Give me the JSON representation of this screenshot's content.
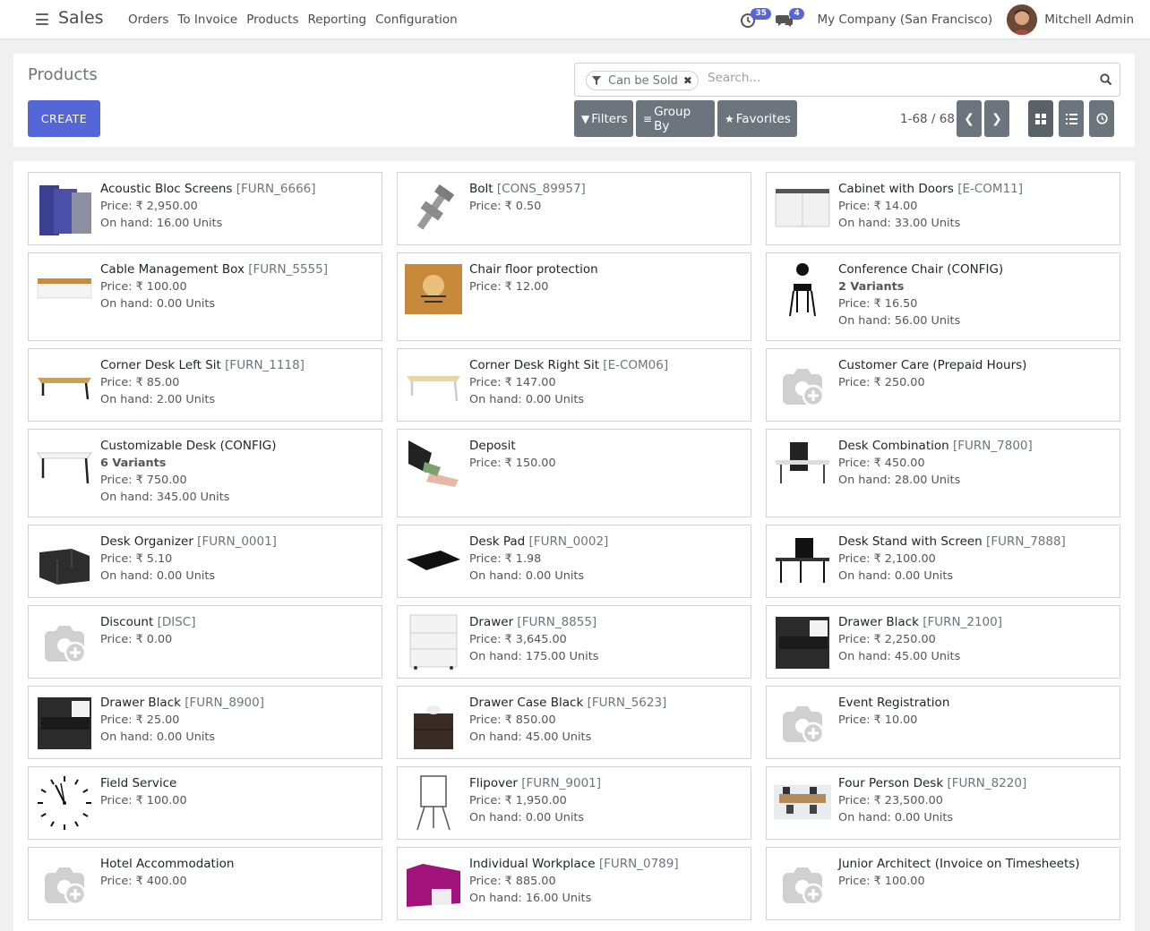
{
  "navbar": {
    "app_name": "Sales",
    "menu": [
      "Orders",
      "To Invoice",
      "Products",
      "Reporting",
      "Configuration"
    ],
    "activity_count": "35",
    "message_count": "4",
    "company": "My Company (San Francisco)",
    "user": "Mitchell Admin"
  },
  "control": {
    "breadcrumb": "Products",
    "create_label": "CREATE",
    "facet_label": "Can be Sold",
    "search_placeholder": "Search...",
    "filters_label": "Filters",
    "groupby_label": "Group By",
    "favorites_label": "Favorites",
    "pager": "1-68 / 68"
  },
  "colors": {
    "primary": "#5466d8",
    "secondary": "#6c757d"
  },
  "products": [
    {
      "name": "Acoustic Bloc Screens",
      "code": "[FURN_6666]",
      "price": "Price: ₹ 2,950.00",
      "onhand": "On hand: 16.00 Units",
      "variants": "",
      "image": "acoustic-screen"
    },
    {
      "name": "Bolt",
      "code": "[CONS_89957]",
      "price": "Price: ₹ 0.50",
      "onhand": "",
      "variants": "",
      "image": "bolt"
    },
    {
      "name": "Cabinet with Doors",
      "code": "[E-COM11]",
      "price": "Price: ₹ 14.00",
      "onhand": "On hand: 33.00 Units",
      "variants": "",
      "image": "cabinet"
    },
    {
      "name": "Cable Management Box",
      "code": "[FURN_5555]",
      "price": "Price: ₹ 100.00",
      "onhand": "On hand: 0.00 Units",
      "variants": "",
      "image": "cable-box"
    },
    {
      "name": "Chair floor protection",
      "code": "",
      "price": "Price: ₹ 12.00",
      "onhand": "",
      "variants": "",
      "image": "floor-protection"
    },
    {
      "name": "Conference Chair (CONFIG)",
      "code": "",
      "price": "Price: ₹ 16.50",
      "onhand": "On hand: 56.00 Units",
      "variants": "2 Variants",
      "image": "chair"
    },
    {
      "name": "Corner Desk Left Sit",
      "code": "[FURN_1118]",
      "price": "Price: ₹ 85.00",
      "onhand": "On hand: 2.00 Units",
      "variants": "",
      "image": "desk-wood"
    },
    {
      "name": "Corner Desk Right Sit",
      "code": "[E-COM06]",
      "price": "Price: ₹ 147.00",
      "onhand": "On hand: 0.00 Units",
      "variants": "",
      "image": "desk-light"
    },
    {
      "name": "Customer Care (Prepaid Hours)",
      "code": "",
      "price": "Price: ₹ 250.00",
      "onhand": "",
      "variants": "",
      "image": "placeholder"
    },
    {
      "name": "Customizable Desk (CONFIG)",
      "code": "",
      "price": "Price: ₹ 750.00",
      "onhand": "On hand: 345.00 Units",
      "variants": "6 Variants",
      "image": "desk-white"
    },
    {
      "name": "Deposit",
      "code": "",
      "price": "Price: ₹ 150.00",
      "onhand": "",
      "variants": "",
      "image": "deposit"
    },
    {
      "name": "Desk Combination",
      "code": "[FURN_7800]",
      "price": "Price: ₹ 450.00",
      "onhand": "On hand: 28.00 Units",
      "variants": "",
      "image": "desk-combo"
    },
    {
      "name": "Desk Organizer",
      "code": "[FURN_0001]",
      "price": "Price: ₹ 5.10",
      "onhand": "On hand: 0.00 Units",
      "variants": "",
      "image": "organizer"
    },
    {
      "name": "Desk Pad",
      "code": "[FURN_0002]",
      "price": "Price: ₹ 1.98",
      "onhand": "On hand: 0.00 Units",
      "variants": "",
      "image": "desk-pad"
    },
    {
      "name": "Desk Stand with Screen",
      "code": "[FURN_7888]",
      "price": "Price: ₹ 2,100.00",
      "onhand": "On hand: 0.00 Units",
      "variants": "",
      "image": "desk-stand"
    },
    {
      "name": "Discount",
      "code": "[DISC]",
      "price": "Price: ₹ 0.00",
      "onhand": "",
      "variants": "",
      "image": "placeholder"
    },
    {
      "name": "Drawer",
      "code": "[FURN_8855]",
      "price": "Price: ₹ 3,645.00",
      "onhand": "On hand: 175.00 Units",
      "variants": "",
      "image": "drawer-white"
    },
    {
      "name": "Drawer Black",
      "code": "[FURN_2100]",
      "price": "Price: ₹ 2,250.00",
      "onhand": "On hand: 45.00 Units",
      "variants": "",
      "image": "drawer-black"
    },
    {
      "name": "Drawer Black",
      "code": "[FURN_8900]",
      "price": "Price: ₹ 25.00",
      "onhand": "On hand: 0.00 Units",
      "variants": "",
      "image": "drawer-black"
    },
    {
      "name": "Drawer Case Black",
      "code": "[FURN_5623]",
      "price": "Price: ₹ 850.00",
      "onhand": "On hand: 45.00 Units",
      "variants": "",
      "image": "drawer-case"
    },
    {
      "name": "Event Registration",
      "code": "",
      "price": "Price: ₹ 10.00",
      "onhand": "",
      "variants": "",
      "image": "placeholder"
    },
    {
      "name": "Field Service",
      "code": "",
      "price": "Price: ₹ 100.00",
      "onhand": "",
      "variants": "",
      "image": "clock"
    },
    {
      "name": "Flipover",
      "code": "[FURN_9001]",
      "price": "Price: ₹ 1,950.00",
      "onhand": "On hand: 0.00 Units",
      "variants": "",
      "image": "flipover"
    },
    {
      "name": "Four Person Desk",
      "code": "[FURN_8220]",
      "price": "Price: ₹ 23,500.00",
      "onhand": "On hand: 0.00 Units",
      "variants": "",
      "image": "four-desk"
    },
    {
      "name": "Hotel Accommodation",
      "code": "",
      "price": "Price: ₹ 400.00",
      "onhand": "",
      "variants": "",
      "image": "placeholder"
    },
    {
      "name": "Individual Workplace",
      "code": "[FURN_0789]",
      "price": "Price: ₹ 885.00",
      "onhand": "On hand: 16.00 Units",
      "variants": "",
      "image": "workplace"
    },
    {
      "name": "Junior Architect (Invoice on Timesheets)",
      "code": "",
      "price": "Price: ₹ 100.00",
      "onhand": "",
      "variants": "",
      "image": "placeholder"
    }
  ]
}
